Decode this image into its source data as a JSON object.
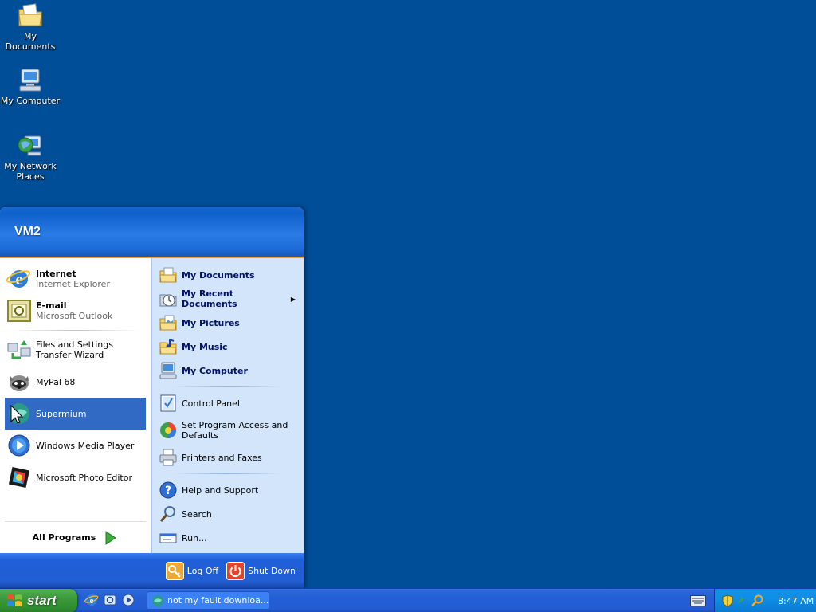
{
  "desktop": {
    "icons": [
      {
        "label": "My Documents",
        "icon": "folder-documents-icon"
      },
      {
        "label": "My Computer",
        "icon": "computer-icon"
      },
      {
        "label": "My Network Places",
        "icon": "network-places-icon"
      }
    ]
  },
  "start_menu": {
    "user": "VM2",
    "pinned": [
      {
        "title": "Internet",
        "subtitle": "Internet Explorer",
        "icon": "internet-explorer-icon"
      },
      {
        "title": "E-mail",
        "subtitle": "Microsoft Outlook",
        "icon": "outlook-icon"
      }
    ],
    "recent": [
      {
        "label": "Files and Settings Transfer Wizard",
        "icon": "transfer-wizard-icon"
      },
      {
        "label": "MyPal 68",
        "icon": "mypal-icon"
      },
      {
        "label": "Supermium",
        "icon": "supermium-icon",
        "highlighted": true
      },
      {
        "label": "Windows Media Player",
        "icon": "media-player-icon"
      },
      {
        "label": "Microsoft Photo Editor",
        "icon": "photo-editor-icon"
      }
    ],
    "all_programs": "All Programs",
    "places": [
      {
        "label": "My Documents",
        "icon": "folder-documents-icon"
      },
      {
        "label": "My Recent Documents",
        "icon": "recent-documents-icon",
        "submenu": true
      },
      {
        "label": "My Pictures",
        "icon": "folder-pictures-icon"
      },
      {
        "label": "My Music",
        "icon": "folder-music-icon"
      },
      {
        "label": "My Computer",
        "icon": "computer-icon"
      }
    ],
    "system": [
      {
        "label": "Control Panel",
        "icon": "control-panel-icon"
      },
      {
        "label": "Set Program Access and Defaults",
        "icon": "program-access-icon"
      },
      {
        "label": "Printers and Faxes",
        "icon": "printer-icon"
      }
    ],
    "help": [
      {
        "label": "Help and Support",
        "icon": "help-icon"
      },
      {
        "label": "Search",
        "icon": "search-icon"
      },
      {
        "label": "Run...",
        "icon": "run-icon"
      }
    ],
    "footer": {
      "log_off": "Log Off",
      "shut_down": "Shut Down"
    }
  },
  "taskbar": {
    "start_label": "start",
    "quick_launch": [
      "internet-explorer-icon",
      "outlook-express-icon",
      "media-player-icon"
    ],
    "window_title": "not my fault downloa...",
    "clock": "8:47 AM"
  },
  "colors": {
    "desktop": "#004e98",
    "menu_header": "#1c6bd7",
    "menu_right": "#d3e5fa",
    "highlight": "#316ac5",
    "start_button": "#3c9a3c"
  }
}
